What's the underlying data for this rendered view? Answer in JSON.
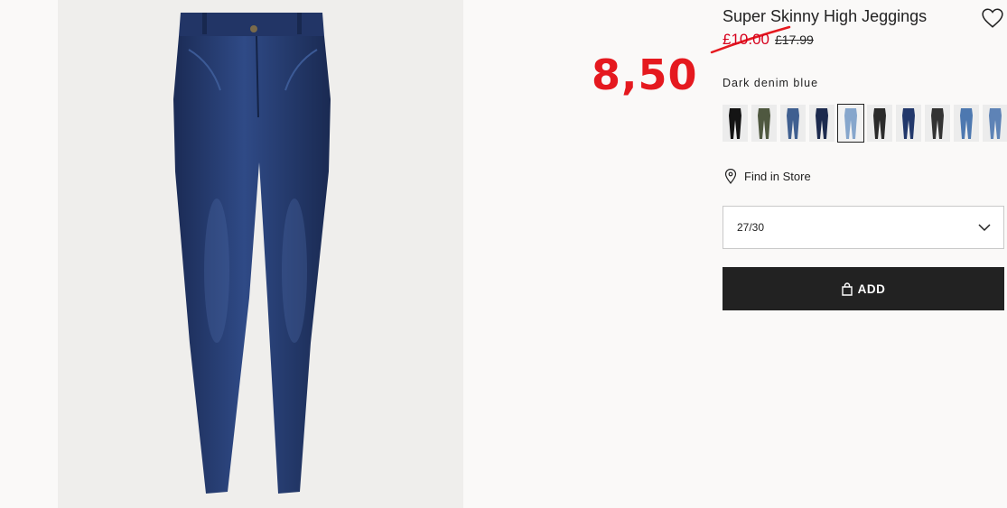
{
  "product": {
    "title": "Super Skinny High Jeggings",
    "sale_price": "£10.00",
    "old_price": "£17.99",
    "color_name": "Dark denim blue",
    "swatch_colors": [
      "#141414",
      "#4f5840",
      "#3f5f90",
      "#1c2a4e",
      "#86a6cc",
      "#2a2a2a",
      "#22386b",
      "#333333",
      "#4d78b0",
      "#5e83b6"
    ],
    "selected_swatch": 4
  },
  "annotation": {
    "new_price": "8,50",
    "color": "#e5191f"
  },
  "find_store": {
    "label": "Find in Store"
  },
  "size_select": {
    "value": "27/30"
  },
  "add_button": {
    "label": "ADD"
  },
  "colors": {
    "accent_sale": "#d6001c",
    "button_bg": "#222222"
  }
}
